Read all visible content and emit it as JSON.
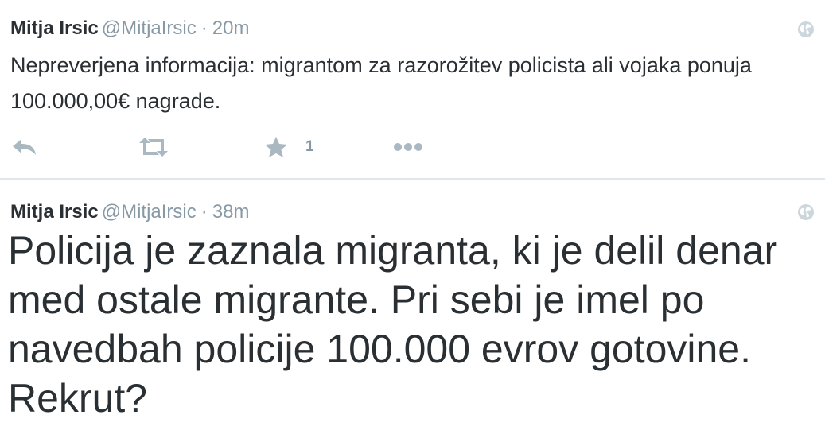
{
  "tweets": [
    {
      "author_name": "Mitja Irsic",
      "handle": "@MitjaIrsic",
      "separator": "·",
      "time": "20m",
      "text": "Nepreverjena informacija: migrantom za razorožitev policista ali vojaka ponuja 100.000,00€ nagrade.",
      "favorite_count": "1",
      "icons": [
        "reply-icon",
        "retweet-icon",
        "favorite-star-icon",
        "more-dots-icon",
        "globe-icon"
      ]
    },
    {
      "author_name": "Mitja Irsic",
      "handle": "@MitjaIrsic",
      "separator": "·",
      "time": "38m",
      "text": "Policija je zaznala migranta, ki je delil denar med ostale migrante. Pri sebi je imel po navedbah policije 100.000 evrov gotovine. Rekrut?",
      "icons": [
        "globe-icon"
      ]
    }
  ],
  "colors": {
    "text": "#292f33",
    "muted": "#8899a6",
    "icon": "#aab8c2",
    "divider": "#e1e8ed",
    "background": "#ffffff"
  }
}
